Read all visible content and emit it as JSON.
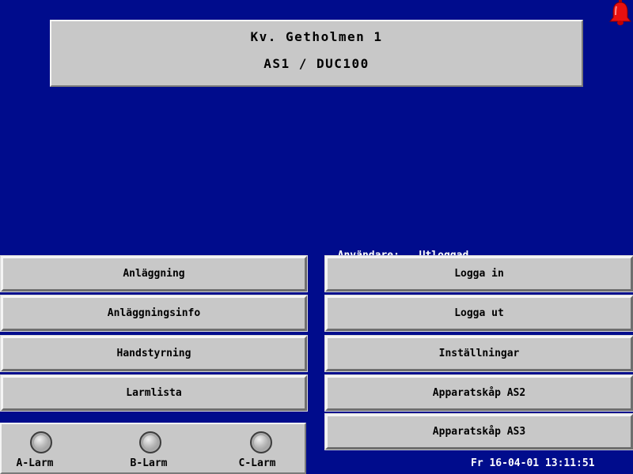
{
  "header": {
    "line1": "Kv. Getholmen 1",
    "line2": "AS1 / DUC100"
  },
  "alarm_bell_icon": "bell-icon",
  "user_status": {
    "label": "Användare:",
    "value": "Utloggad"
  },
  "left_menu": [
    {
      "label": "Anläggning"
    },
    {
      "label": "Anläggningsinfo"
    },
    {
      "label": "Handstyrning"
    },
    {
      "label": "Larmlista"
    }
  ],
  "right_menu": [
    {
      "label": "Logga in"
    },
    {
      "label": "Logga ut"
    },
    {
      "label": "Inställningar"
    },
    {
      "label": "Apparatskåp AS2"
    },
    {
      "label": "Apparatskåp AS3"
    }
  ],
  "alarms": [
    {
      "label": "A-Larm"
    },
    {
      "label": "B-Larm"
    },
    {
      "label": "C-Larm"
    }
  ],
  "datetime": "Fr 16-04-01 13:11:51",
  "colors": {
    "background": "#000c8c",
    "panel": "#c8c8c8",
    "bell": "#e81010",
    "text_on_bg": "#ffffff"
  }
}
